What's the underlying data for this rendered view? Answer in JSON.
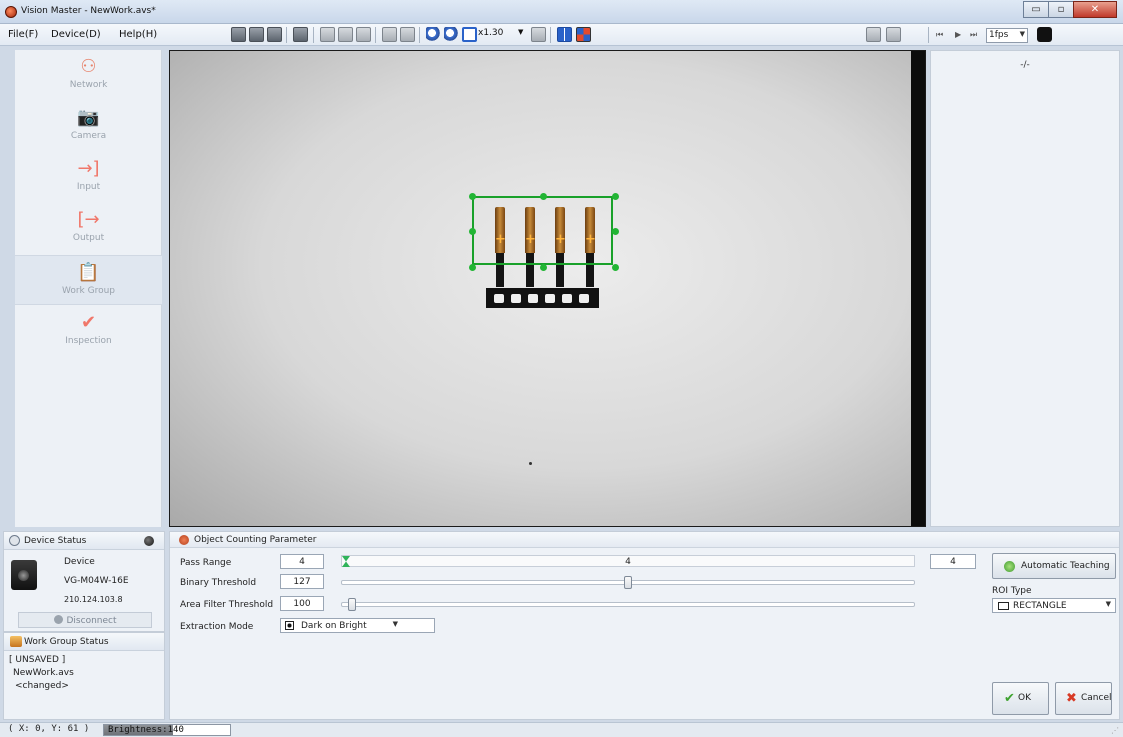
{
  "window": {
    "title": "Vision Master - NewWork.avs*",
    "min_glyph": "▭",
    "max_glyph": "▫",
    "close_glyph": "✕"
  },
  "menu": [
    "File(F)",
    "Device(D)",
    "Help(H)"
  ],
  "toolbar": {
    "zoom": "x1.30",
    "fps": "1fps",
    "nav_glyphs": [
      "⏮",
      "▶",
      "⏭"
    ]
  },
  "sidebar": {
    "items": [
      {
        "label": "Network",
        "icon": "network-icon",
        "glyph": "⚇"
      },
      {
        "label": "Camera",
        "icon": "camera-icon",
        "glyph": "📷"
      },
      {
        "label": "Input",
        "icon": "input-icon",
        "glyph": "→]"
      },
      {
        "label": "Output",
        "icon": "output-icon",
        "glyph": "[→"
      },
      {
        "label": "Work Group",
        "icon": "work-group-icon",
        "glyph": "📋"
      },
      {
        "label": "Inspection",
        "icon": "inspection-icon",
        "glyph": "✔"
      }
    ],
    "active": "Work Group"
  },
  "viewer": {
    "objects_counted": 4
  },
  "results": {
    "text": "-/-"
  },
  "device_status": {
    "title": "Device Status",
    "device_label": "Device",
    "model": "VG-M04W-16E",
    "ip": "210.124.103.8",
    "disconnect_label": "Disconnect"
  },
  "work_group_status": {
    "title": "Work Group Status",
    "lines": [
      "[ UNSAVED ]",
      "NewWork.avs",
      "<changed>"
    ]
  },
  "parameters": {
    "title": "Object Counting Parameter",
    "pass_range": {
      "label": "Pass Range",
      "min": "4",
      "max": "4",
      "center": "4"
    },
    "binary_threshold": {
      "label": "Binary Threshold",
      "value": "127",
      "fraction": 0.498
    },
    "area_filter": {
      "label": "Area Filter Threshold",
      "value": "100",
      "fraction": 0.01
    },
    "extraction_mode": {
      "label": "Extraction Mode",
      "value": "Dark on Bright"
    },
    "auto_teaching_label": "Automatic Teaching",
    "roi_type_label": "ROI Type",
    "roi_type_value": "RECTANGLE",
    "ok_label": "OK",
    "cancel_label": "Cancel"
  },
  "statusbar": {
    "coords": "( X:  0, Y: 61 )",
    "brightness": "Brightness:140",
    "brightness_value": 140,
    "brightness_max": 255
  },
  "colors": {
    "roi_green": "#19a12a",
    "accent_orange": "#ffb43c",
    "close_red": "#c0392b"
  }
}
